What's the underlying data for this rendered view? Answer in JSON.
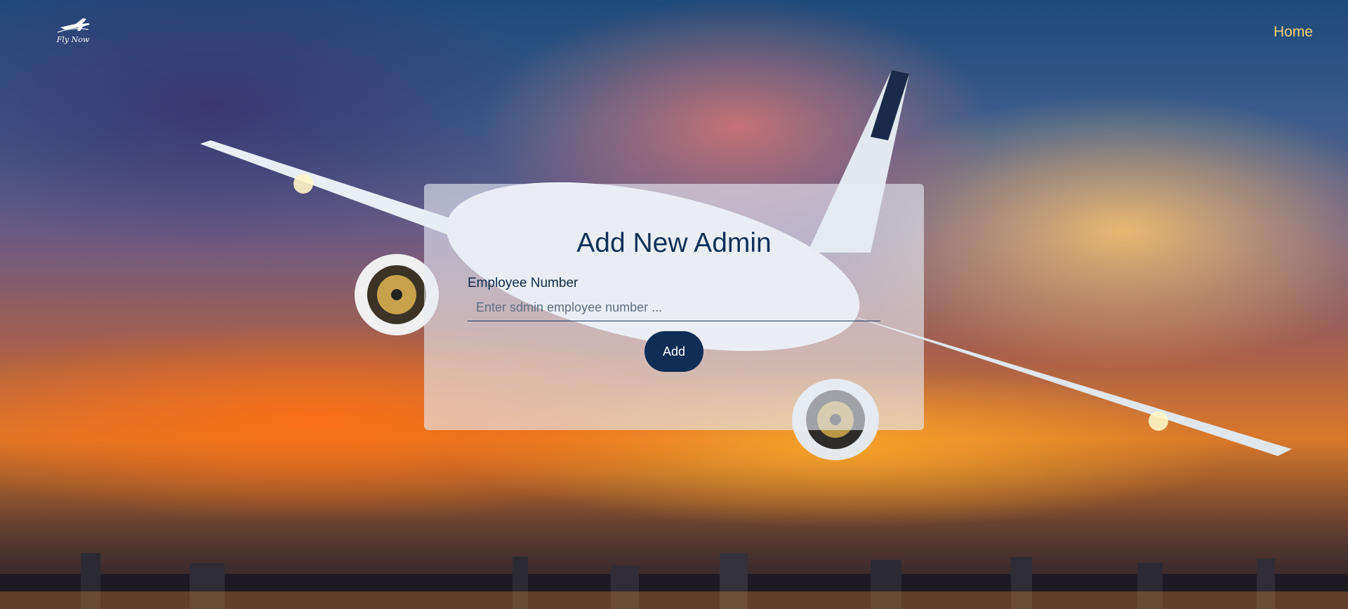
{
  "header": {
    "logo_text": "Fly Now",
    "logo_icon": "airplane-icon",
    "nav_home_label": "Home"
  },
  "form": {
    "title": "Add New Admin",
    "employee_number": {
      "label": "Employee Number",
      "value": "",
      "placeholder": "Enter sdmin employee number ..."
    },
    "submit_label": "Add"
  },
  "colors": {
    "nav_link": "#f3d36b",
    "title_text": "#10305a",
    "button_bg": "#0f2d55",
    "card_bg": "#e6ecf4"
  }
}
